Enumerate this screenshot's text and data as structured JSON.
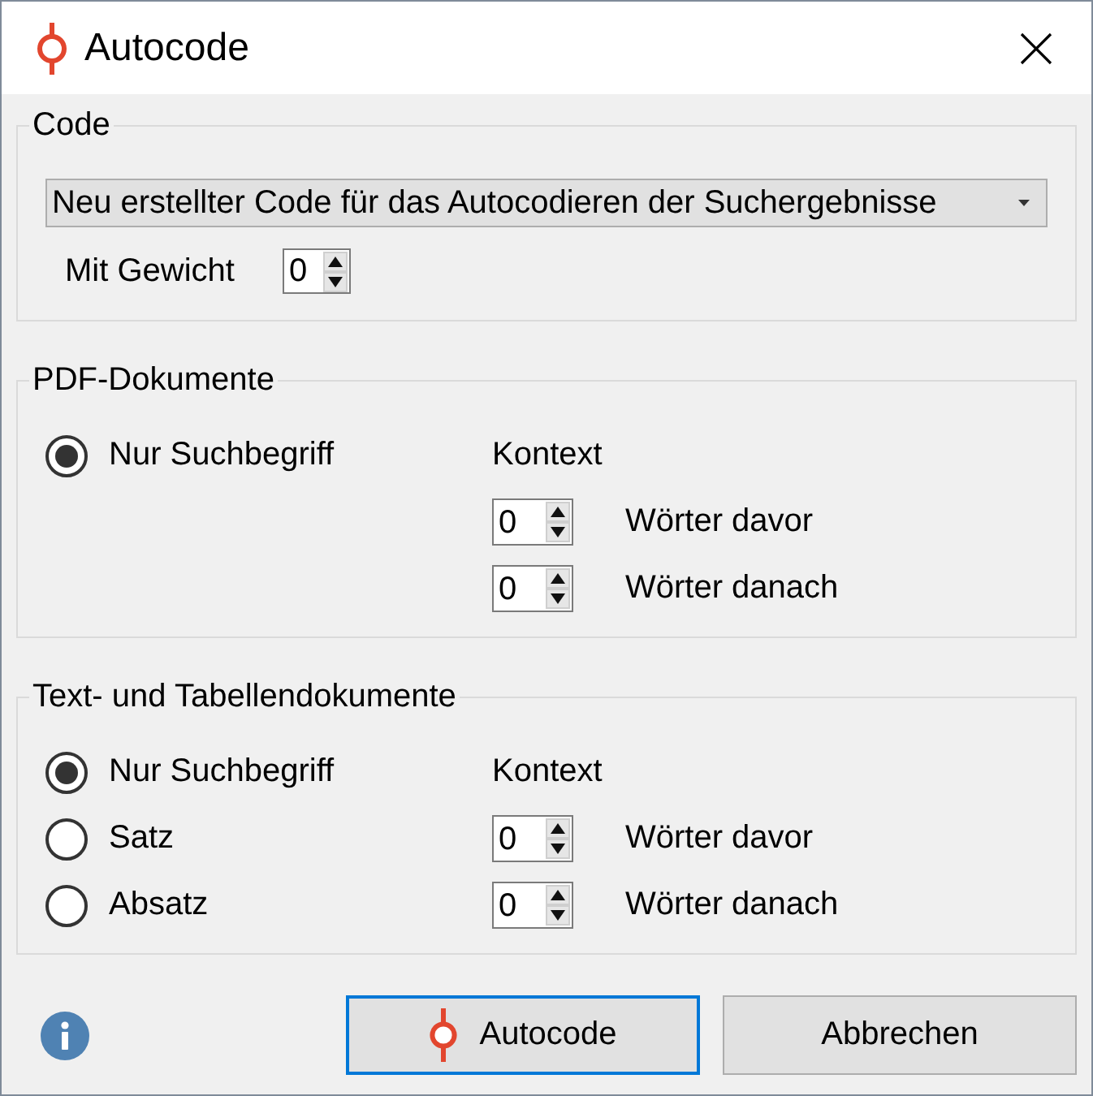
{
  "window": {
    "title": "Autocode"
  },
  "groups": [
    {
      "kind": "code",
      "title": "Code",
      "dropdown": {
        "value": "Neu erstellter Code für das Autocodieren der Suchergebnisse"
      },
      "weight": {
        "label": "Mit Gewicht",
        "value": "0"
      }
    },
    {
      "kind": "scope",
      "title": "PDF-Dokumente",
      "options": [
        {
          "label": "Nur Suchbegriff",
          "selected": true
        }
      ],
      "context": {
        "label": "Kontext",
        "fields": [
          {
            "value": "0",
            "label": "Wörter davor"
          },
          {
            "value": "0",
            "label": "Wörter danach"
          }
        ]
      }
    },
    {
      "kind": "scope",
      "title": "Text- und Tabellendokumente",
      "options": [
        {
          "label": "Nur Suchbegriff",
          "selected": true
        },
        {
          "label": "Satz",
          "selected": false
        },
        {
          "label": "Absatz",
          "selected": false
        }
      ],
      "context": {
        "label": "Kontext",
        "fields": [
          {
            "value": "0",
            "label": "Wörter davor"
          },
          {
            "value": "0",
            "label": "Wörter danach"
          }
        ]
      }
    }
  ],
  "buttons": [
    {
      "label": "Autocode",
      "kind": "primary",
      "focused": true
    },
    {
      "label": "Abbrechen",
      "kind": "plain",
      "focused": false
    }
  ]
}
